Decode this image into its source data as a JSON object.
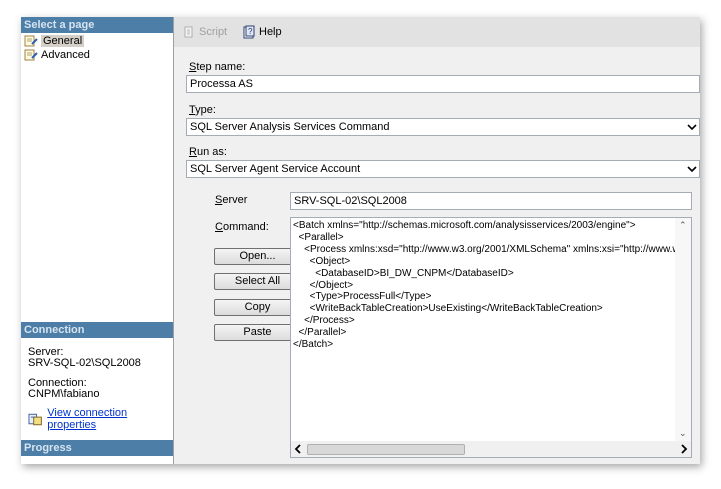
{
  "left": {
    "select_page_header": "Select a page",
    "pages": [
      {
        "label": "General",
        "selected": true
      },
      {
        "label": "Advanced",
        "selected": false
      }
    ],
    "connection_header": "Connection",
    "server_label": "Server:",
    "server_value": "SRV-SQL-02\\SQL2008",
    "connection_label": "Connection:",
    "connection_value": "CNPM\\fabiano",
    "view_link": "View connection properties",
    "progress_header": "Progress"
  },
  "toolbar": {
    "script_label": "Script",
    "help_label": "Help"
  },
  "form": {
    "step_name_label_u": "S",
    "step_name_label_rest": "tep name:",
    "step_name_value": "Processa AS",
    "type_label_u": "T",
    "type_label_rest": "ype:",
    "type_value": "SQL Server Analysis Services Command",
    "run_as_label_u": "R",
    "run_as_label_rest": "un as:",
    "run_as_value": "SQL Server Agent Service Account",
    "server_label_u": "S",
    "server_label_rest": "erver",
    "server_value": "SRV-SQL-02\\SQL2008",
    "command_label_u": "C",
    "command_label_rest": "ommand:",
    "buttons": {
      "open": "Open...",
      "select_all": "Select All",
      "copy": "Copy",
      "paste": "Paste"
    },
    "command_text": "<Batch xmlns=\"http://schemas.microsoft.com/analysisservices/2003/engine\">\n  <Parallel>\n    <Process xmlns:xsd=\"http://www.w3.org/2001/XMLSchema\" xmlns:xsi=\"http://www.w3.org\n      <Object>\n        <DatabaseID>BI_DW_CNPM</DatabaseID>\n      </Object>\n      <Type>ProcessFull</Type>\n      <WriteBackTableCreation>UseExisting</WriteBackTableCreation>\n    </Process>\n  </Parallel>\n</Batch>"
  },
  "colors": {
    "section_header_bg": "#4d7ea8",
    "link": "#0033cc"
  }
}
